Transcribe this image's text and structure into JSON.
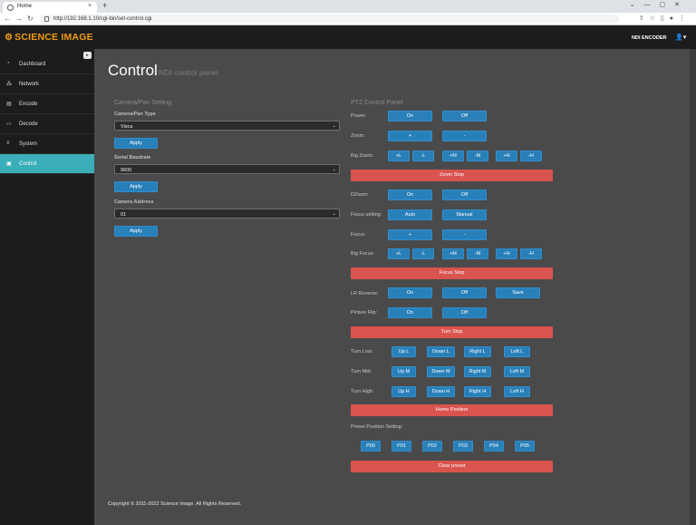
{
  "browser": {
    "tab_title": "Home",
    "url": "http://192.168.1.10/cgi-bin/set-control.cgi"
  },
  "header": {
    "brand": "SCIENCE IMAGE",
    "product": "NDI ENCODER"
  },
  "sidebar": {
    "items": [
      {
        "label": "Dashboard",
        "icon": "dashboard-icon"
      },
      {
        "label": "Network",
        "icon": "network-icon"
      },
      {
        "label": "Encode",
        "icon": "encode-icon"
      },
      {
        "label": "Decode",
        "icon": "decode-icon"
      },
      {
        "label": "System",
        "icon": "system-icon"
      },
      {
        "label": "Control",
        "icon": "control-icon",
        "active": true
      }
    ]
  },
  "page": {
    "title": "Control",
    "subtitle": "NDI control panel"
  },
  "camera": {
    "heading": "Camera/Pan Setting",
    "type_label": "Camera/Pan Type",
    "type_value": "Visca",
    "baud_label": "Serial Baudrate",
    "baud_value": "9600",
    "addr_label": "Camera Address",
    "addr_value": "01",
    "apply_label": "Apply"
  },
  "ptz": {
    "heading": "PTZ Control Panel",
    "power": {
      "label": "Power:",
      "on": "On",
      "off": "Off"
    },
    "zoom": {
      "label": "Zoom:",
      "plus": "+",
      "minus": "-"
    },
    "big_zoom": {
      "label": "Big Zoom:",
      "buttons": [
        "+L",
        "-L",
        "+M",
        "-M",
        "+H",
        "-H"
      ]
    },
    "zoom_stop": "Zoom Stop",
    "dzoom": {
      "label": "DZoom:",
      "on": "On",
      "off": "Off"
    },
    "focus_setting": {
      "label": "Focus setting:",
      "auto": "Auto",
      "manual": "Manual"
    },
    "focus": {
      "label": "Focus:",
      "plus": "+",
      "minus": "-"
    },
    "big_focus": {
      "label": "Big Focus:",
      "buttons": [
        "+L",
        "-L",
        "+M",
        "-M",
        "+H",
        "-H"
      ]
    },
    "focus_stop": "Focus Stop",
    "lr_reverse": {
      "label": "LR Reverse:",
      "on": "On",
      "off": "Off",
      "save": "Save"
    },
    "picture_flip": {
      "label": "Picture Flip:",
      "on": "On",
      "off": "Off"
    },
    "turn_stop": "Turn Stop",
    "turn_low": {
      "label": "Turn Low:",
      "buttons": [
        "Up L",
        "Down L",
        "Right L",
        "Left L"
      ]
    },
    "turn_mid": {
      "label": "Turn Mid:",
      "buttons": [
        "Up M",
        "Down M",
        "Right M",
        "Left M"
      ]
    },
    "turn_high": {
      "label": "Turn High:",
      "buttons": [
        "Up H",
        "Down H",
        "Right H",
        "Left H"
      ]
    },
    "home_position": "Home Position",
    "preset_label": "Preset Position Setting:",
    "presets": [
      "P00",
      "P01",
      "P02",
      "P03",
      "P04",
      "P05"
    ],
    "clear_preset": "Clear preset"
  },
  "footer": "Copyright © 2011-2022 Science Image. All Rights Reserved.",
  "colors": {
    "accent": "#3aafb9",
    "brand": "#f39c12",
    "primary_button": "#2980b9",
    "danger_button": "#d9534f",
    "background": "#4a4a4a",
    "sidebar": "#1c1c1c"
  }
}
